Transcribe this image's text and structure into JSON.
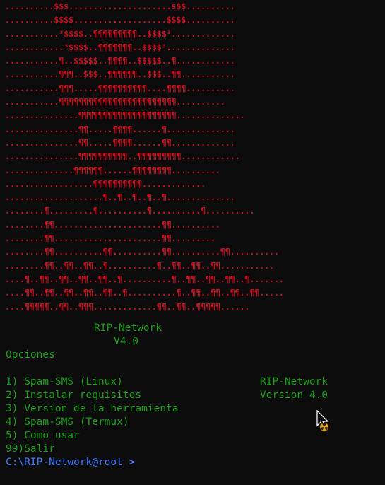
{
  "art_lines": [
    "..........$$s.....................s$$..........",
    "..........$$$$...................$$$$..........",
    "...........³$$$$..¶¶¶¶¶¶¶¶¶..$$$$³.............",
    "............³$$$$..¶¶¶¶¶¶¶..$$$$³..............",
    "...........¶..$$$$$..¶¶¶¶..$$$$$..¶............",
    "...........¶¶¶..$$$..¶¶¶¶¶¶..$$$..¶¶...........",
    "...........¶¶¶.....¶¶¶¶¶¶¶¶¶¶....¶¶¶¶..........",
    "...........¶¶¶¶¶¶¶¶¶¶¶¶¶¶¶¶¶¶¶¶¶¶¶¶..........",
    "...............¶¶¶¶¶¶¶¶¶¶¶¶¶¶¶¶¶¶¶¶..............",
    "...............¶¶.....¶¶¶¶......¶..............",
    "...............¶¶.....¶¶¶¶......¶¶.............",
    "...............¶¶¶¶¶¶¶¶¶¶..¶¶¶¶¶¶¶¶¶............",
    "..............¶¶¶¶¶¶......¶¶¶¶¶¶¶¶..........",
    "..................¶¶¶¶¶¶¶¶¶¶.............",
    "....................¶..¶..¶..¶..¶..............",
    "........¶.........¶..........¶..........¶..........",
    "........¶¶......................¶¶..........",
    "........¶¶......................¶¶.........",
    "........¶¶..........¶¶..........¶¶..........¶¶..........",
    "........¶¶..¶¶..¶¶..¶..........¶..¶¶..¶¶..¶¶...........",
    "....¶..¶¶..¶¶..¶¶..¶¶..¶..........¶..¶¶..¶¶..¶¶..¶.......",
    "....¶¶..¶¶..¶¶..¶¶..¶¶..¶..........¶..¶¶..¶¶..¶¶..¶¶.....",
    "....¶¶¶¶¶..¶¶..¶¶¶.............¶¶..¶¶..¶¶¶¶¶......"
  ],
  "banner": {
    "title": "RIP-Network",
    "version": "V4.0"
  },
  "menu": {
    "heading": "Opciones",
    "items": [
      "1) Spam-SMS (Linux)",
      "2) Instalar requisitos",
      "3) Version de la herramienta",
      "4) Spam-SMS (Termux)",
      "5) Como usar",
      "99)Salir"
    ]
  },
  "side_info": {
    "title": "RIP-Network",
    "version": "Version 4.0"
  },
  "prompt": "C:\\RIP-Network@root >",
  "colors": {
    "background": "#0c0c0c",
    "art_red": "#c50f1f",
    "text_green": "#13a10e",
    "prompt_blue": "#3b78ff"
  }
}
